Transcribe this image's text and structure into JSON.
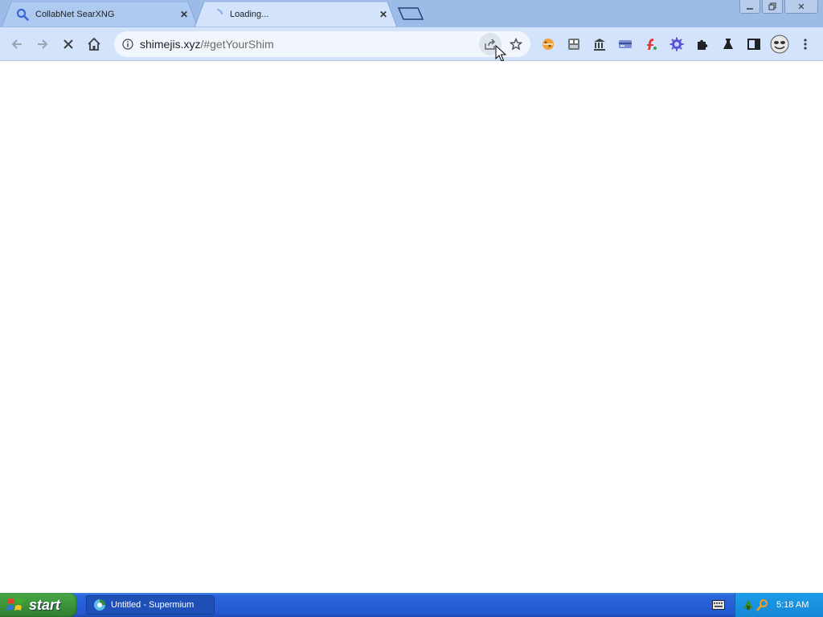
{
  "tabs": [
    {
      "title": "CollabNet SearXNG",
      "favicon": "search-icon",
      "active": false
    },
    {
      "title": "Loading...",
      "favicon": "loading-spinner-icon",
      "active": true
    }
  ],
  "toolbar": {
    "url_host": "shimejis.xyz",
    "url_path": "/#getYourShim",
    "extensions": [
      "cookie-extension-icon",
      "grid-extension-icon",
      "bank-extension-icon",
      "card-extension-icon",
      "flash-extension-icon",
      "gear-extension-icon",
      "puzzle-icon",
      "flask-icon",
      "sidepanel-icon",
      "avatar-icon",
      "menu-kebab-icon"
    ]
  },
  "taskbar": {
    "start_label": "start",
    "task_label": "Untitled - Supermium",
    "clock": "5:18 AM"
  },
  "colors": {
    "tabstrip": "#9cbbe6",
    "toolbar": "#d3e3fb",
    "taskbar": "#2358d2",
    "start": "#3c973c"
  }
}
